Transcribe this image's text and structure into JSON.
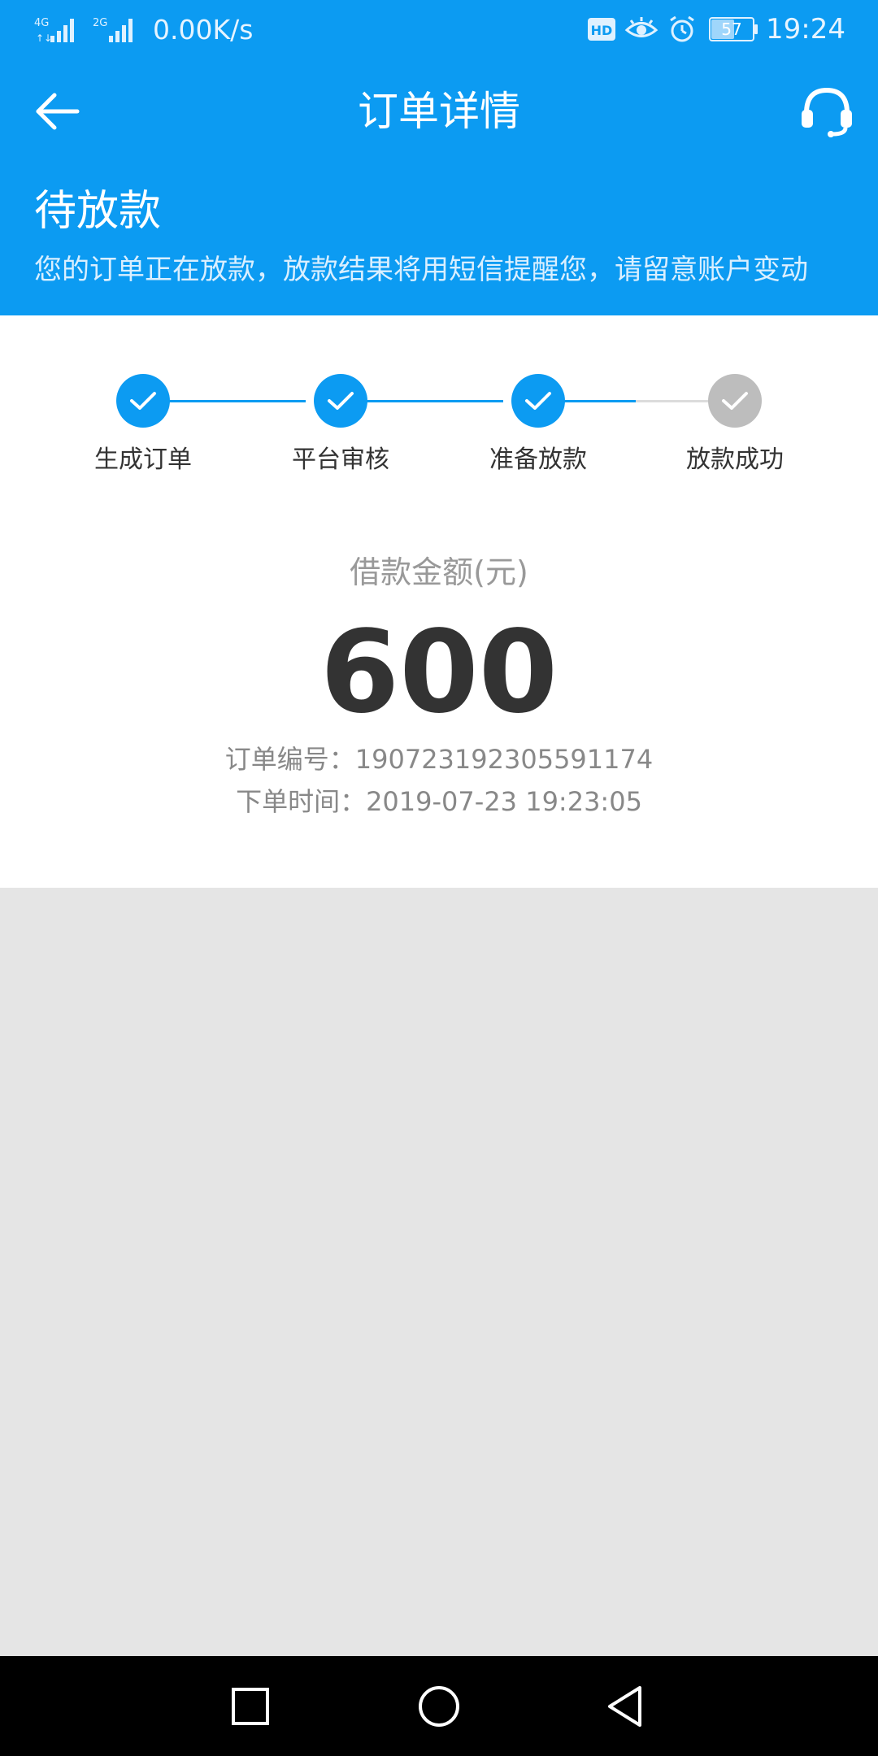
{
  "status_bar": {
    "net_speed": "0.00K/s",
    "battery": "57",
    "time": "19:24",
    "icons": [
      "signal-4g-icon",
      "signal-2g-icon",
      "hd-icon",
      "eye-icon",
      "alarm-icon",
      "battery-icon"
    ]
  },
  "app_bar": {
    "title": "订单详情",
    "back_icon": "arrow-left-icon",
    "support_icon": "headset-icon"
  },
  "status_header": {
    "title": "待放款",
    "description": "您的订单正在放款，放款结果将用短信提醒您，请留意账户变动"
  },
  "steps": [
    {
      "label": "生成订单",
      "done": true
    },
    {
      "label": "平台审核",
      "done": true
    },
    {
      "label": "准备放款",
      "done": true
    },
    {
      "label": "放款成功",
      "done": false
    }
  ],
  "loan": {
    "amount_label": "借款金额(元)",
    "amount": "600",
    "order_no": "订单编号：190723192305591174",
    "order_time": "下单时间：2019-07-23 19:23:05"
  },
  "colors": {
    "primary": "#0c9bf2",
    "step_done": "#0c9bf2",
    "step_pending": "#bdbdbd",
    "page_bg": "#e5e5e5"
  },
  "nav_bar": {
    "icons": [
      "recents-square-icon",
      "home-circle-icon",
      "back-triangle-icon"
    ]
  }
}
